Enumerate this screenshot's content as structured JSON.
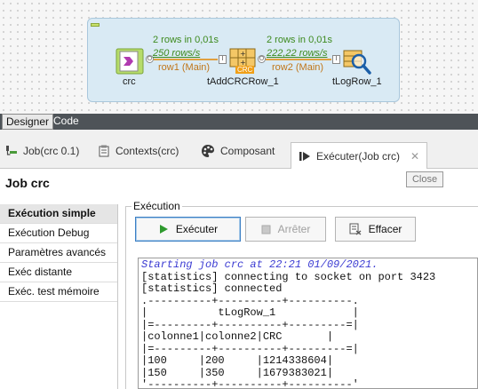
{
  "designer": {
    "components": [
      {
        "name": "crc",
        "icon": "crc-component-icon"
      },
      {
        "name": "tAddCRCRow_1",
        "icon": "add-crc-row-icon",
        "badge": "CRC"
      },
      {
        "name": "tLogRow_1",
        "icon": "log-row-icon"
      }
    ],
    "links": [
      {
        "stat_rows": "2 rows in 0,01s",
        "stat_rate": "250 rows/s",
        "name": "row1 (Main)"
      },
      {
        "stat_rows": "2 rows in 0,01s",
        "stat_rate": "222,22 rows/s",
        "name": "row2 (Main)"
      }
    ],
    "port_labels": {
      "output": "O",
      "input": "I"
    }
  },
  "editor_tabs": [
    "Designer",
    "Code"
  ],
  "view_tabs": [
    {
      "label": "Job(crc 0.1)",
      "icon": "job-icon"
    },
    {
      "label": "Contexts(crc)",
      "icon": "contexts-icon"
    },
    {
      "label": "Composant",
      "icon": "palette-icon"
    },
    {
      "label": "Exécuter(Job crc)",
      "icon": "run-icon",
      "active": true,
      "close": "✕"
    }
  ],
  "close_tooltip": "Close",
  "run_view": {
    "title": "Job crc",
    "sidebar": [
      {
        "label": "Exécution simple",
        "active": true
      },
      {
        "label": "Exécution Debug"
      },
      {
        "label": "Paramètres avancés"
      },
      {
        "label": "Exéc distante"
      },
      {
        "label": "Exéc. test mémoire"
      }
    ],
    "group_label": "Exécution",
    "buttons": {
      "run": "Exécuter",
      "stop": "Arrêter",
      "clear": "Effacer"
    },
    "console": {
      "start_line": "Starting job crc at 22:21 01/09/2021.",
      "lines": [
        "[statistics] connecting to socket on port 3423",
        "[statistics] connected",
        ".----------+----------+----------.",
        "|           tLogRow_1            |",
        "|=---------+----------+---------=|",
        "|colonne1|colonne2|CRC       |",
        "|=---------+----------+---------=|",
        "|100     |200     |1214338604|",
        "|150     |350     |1679383021|",
        "'----------+----------+----------'"
      ]
    }
  },
  "colors": {
    "subjob_bg": "#d9eaf4",
    "link": "#e0a040",
    "stat": "#3d8a1e",
    "row_name": "#c0761a",
    "start_line": "#3b3bd2",
    "run_green": "#2e9a2e"
  }
}
